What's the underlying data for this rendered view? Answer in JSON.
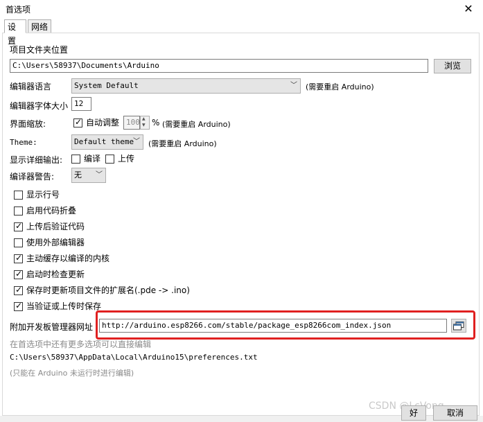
{
  "window": {
    "title": "首选项",
    "close": "✕"
  },
  "tabs": [
    {
      "label": "设置"
    },
    {
      "label": "网络"
    }
  ],
  "sketchbook": {
    "label": "项目文件夹位置",
    "path": "C:\\Users\\58937\\Documents\\Arduino",
    "browse": "浏览"
  },
  "editor_language": {
    "label": "编辑器语言",
    "value": "System Default",
    "note": "(需要重启 Arduino)"
  },
  "editor_font_size": {
    "label": "编辑器字体大小",
    "value": "12"
  },
  "interface_scale": {
    "label": "界面缩放:",
    "auto_label": "自动调整",
    "auto_checked": true,
    "value": "100",
    "unit": "%",
    "note": "(需要重启 Arduino)"
  },
  "theme": {
    "label": "Theme:",
    "value": "Default theme",
    "note": "(需要重启 Arduino)"
  },
  "verbose": {
    "label": "显示详细输出:",
    "compile_label": "编译",
    "compile_checked": false,
    "upload_label": "上传",
    "upload_checked": false
  },
  "compiler_warnings": {
    "label": "编译器警告:",
    "value": "无"
  },
  "options": [
    {
      "label": "显示行号",
      "checked": false
    },
    {
      "label": "启用代码折叠",
      "checked": false
    },
    {
      "label": "上传后验证代码",
      "checked": true
    },
    {
      "label": "使用外部编辑器",
      "checked": false
    },
    {
      "label": "主动缓存以编译的内核",
      "checked": true
    },
    {
      "label": "启动时检查更新",
      "checked": true
    },
    {
      "label": "保存时更新项目文件的扩展名(.pde -> .ino)",
      "checked": true
    },
    {
      "label": "当验证或上传时保存",
      "checked": true
    }
  ],
  "board_urls": {
    "label": "附加开发板管理器网址",
    "value": "http://arduino.esp8266.com/stable/package_esp8266com_index.json"
  },
  "more_prefs_note": "在首选项中还有更多选项可以直接编辑",
  "prefs_path": "C:\\Users\\58937\\AppData\\Local\\Arduino15\\preferences.txt",
  "edit_note": "(只能在 Arduino 未运行时进行编辑)",
  "footer": {
    "ok": "好",
    "cancel": "取消"
  },
  "watermark": "CSDN @LcVong",
  "icons": {
    "check": "✓",
    "dropdown": "﹀",
    "up": "▲",
    "down": "▼"
  }
}
